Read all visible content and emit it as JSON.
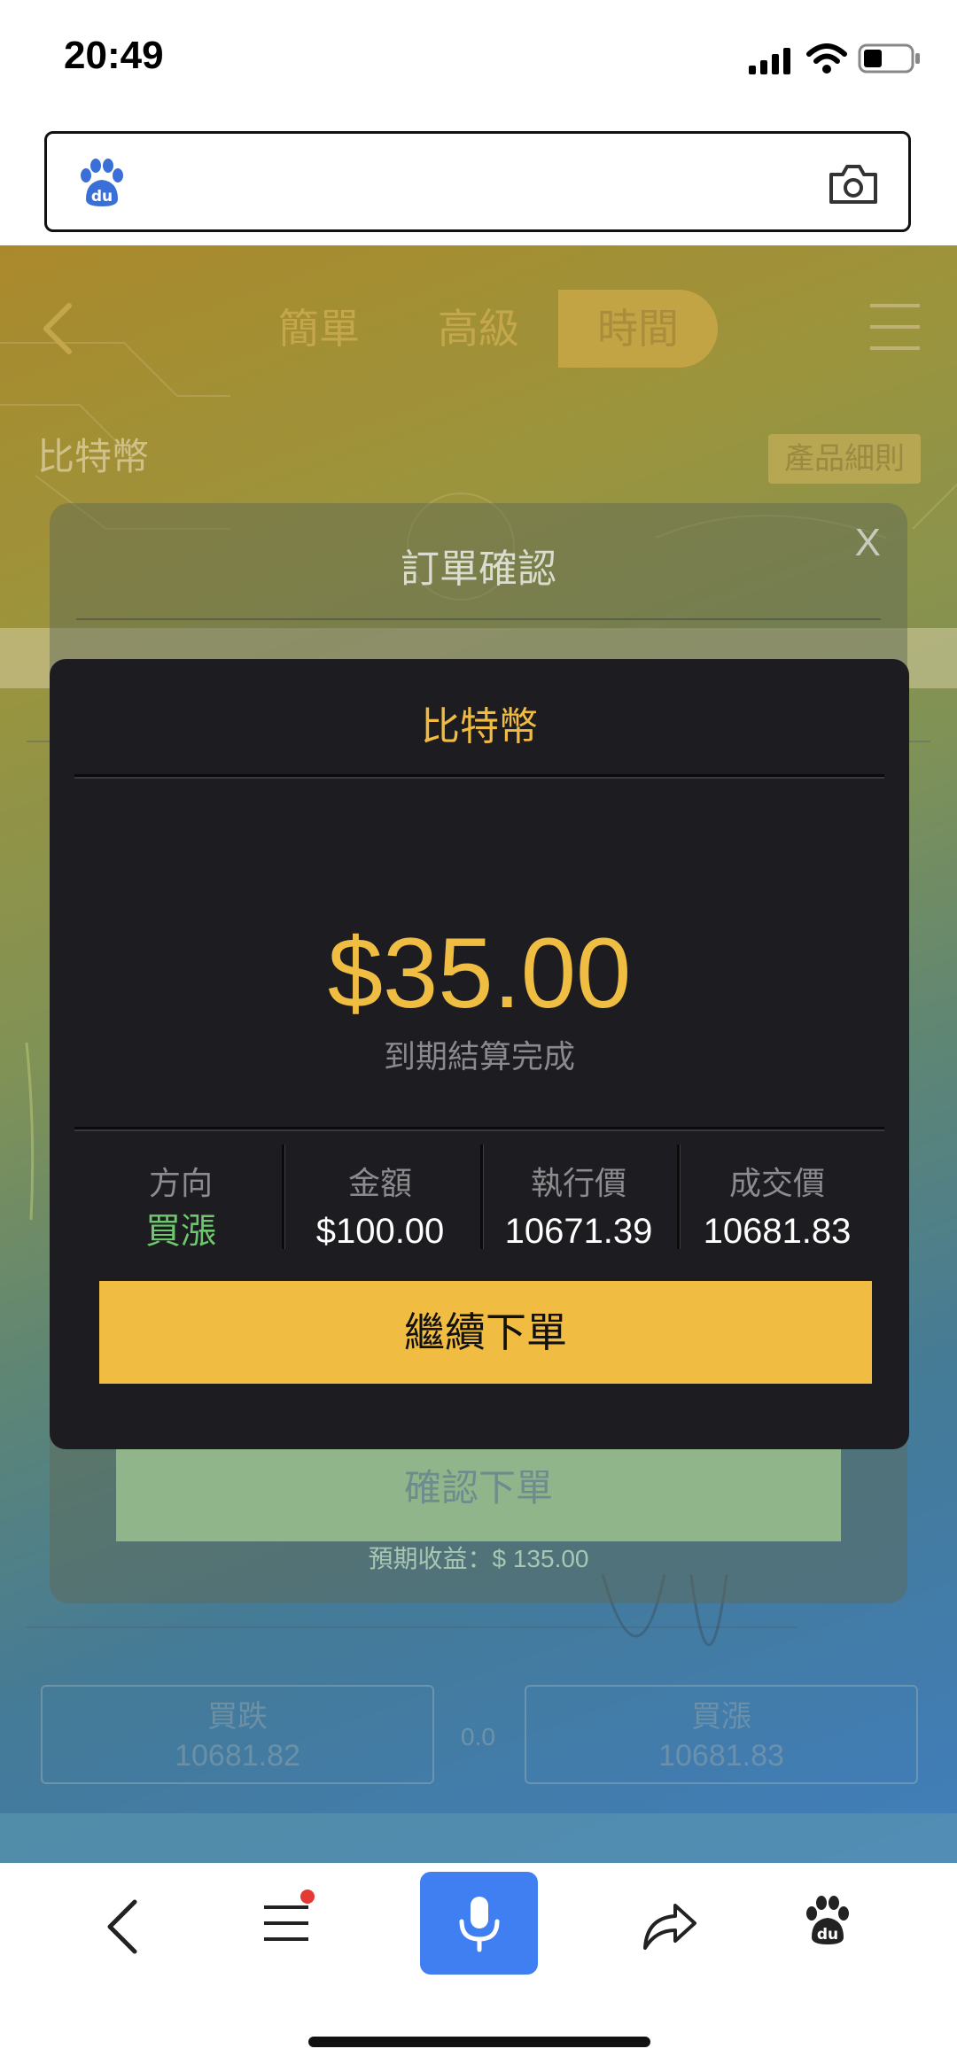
{
  "status": {
    "time": "20:49"
  },
  "app": {
    "tabs": [
      "簡單",
      "高級",
      "時間"
    ],
    "coin_title": "比特幣",
    "rules_button": "產品細則",
    "sell": {
      "label": "買跌",
      "price": "10681.82"
    },
    "spread": "0.0",
    "buy": {
      "label": "買漲",
      "price": "10681.83"
    }
  },
  "confirm": {
    "title": "訂單確認",
    "close": "X",
    "confirm_button": "確認下單",
    "expected_profit": "預期收益：$ 135.00"
  },
  "result": {
    "title": "比特幣",
    "amount": "$35.00",
    "status": "到期結算完成",
    "columns": [
      {
        "label": "方向",
        "value": "買漲",
        "color": "#6fc76d"
      },
      {
        "label": "金額",
        "value": "$100.00",
        "color": "#ffffff"
      },
      {
        "label": "執行價",
        "value": "10671.39",
        "color": "#ffffff"
      },
      {
        "label": "成交價",
        "value": "10681.83",
        "color": "#ffffff"
      }
    ],
    "continue_button": "繼續下單"
  },
  "colors": {
    "accent": "#f0bd42",
    "mic": "#3f7ff1",
    "notification": "#e53935"
  },
  "icons": [
    "baidu-paw-icon",
    "camera-icon",
    "back-chevron-icon",
    "menu-icon",
    "mic-icon",
    "share-icon",
    "signal-icon",
    "wifi-icon",
    "battery-icon"
  ]
}
